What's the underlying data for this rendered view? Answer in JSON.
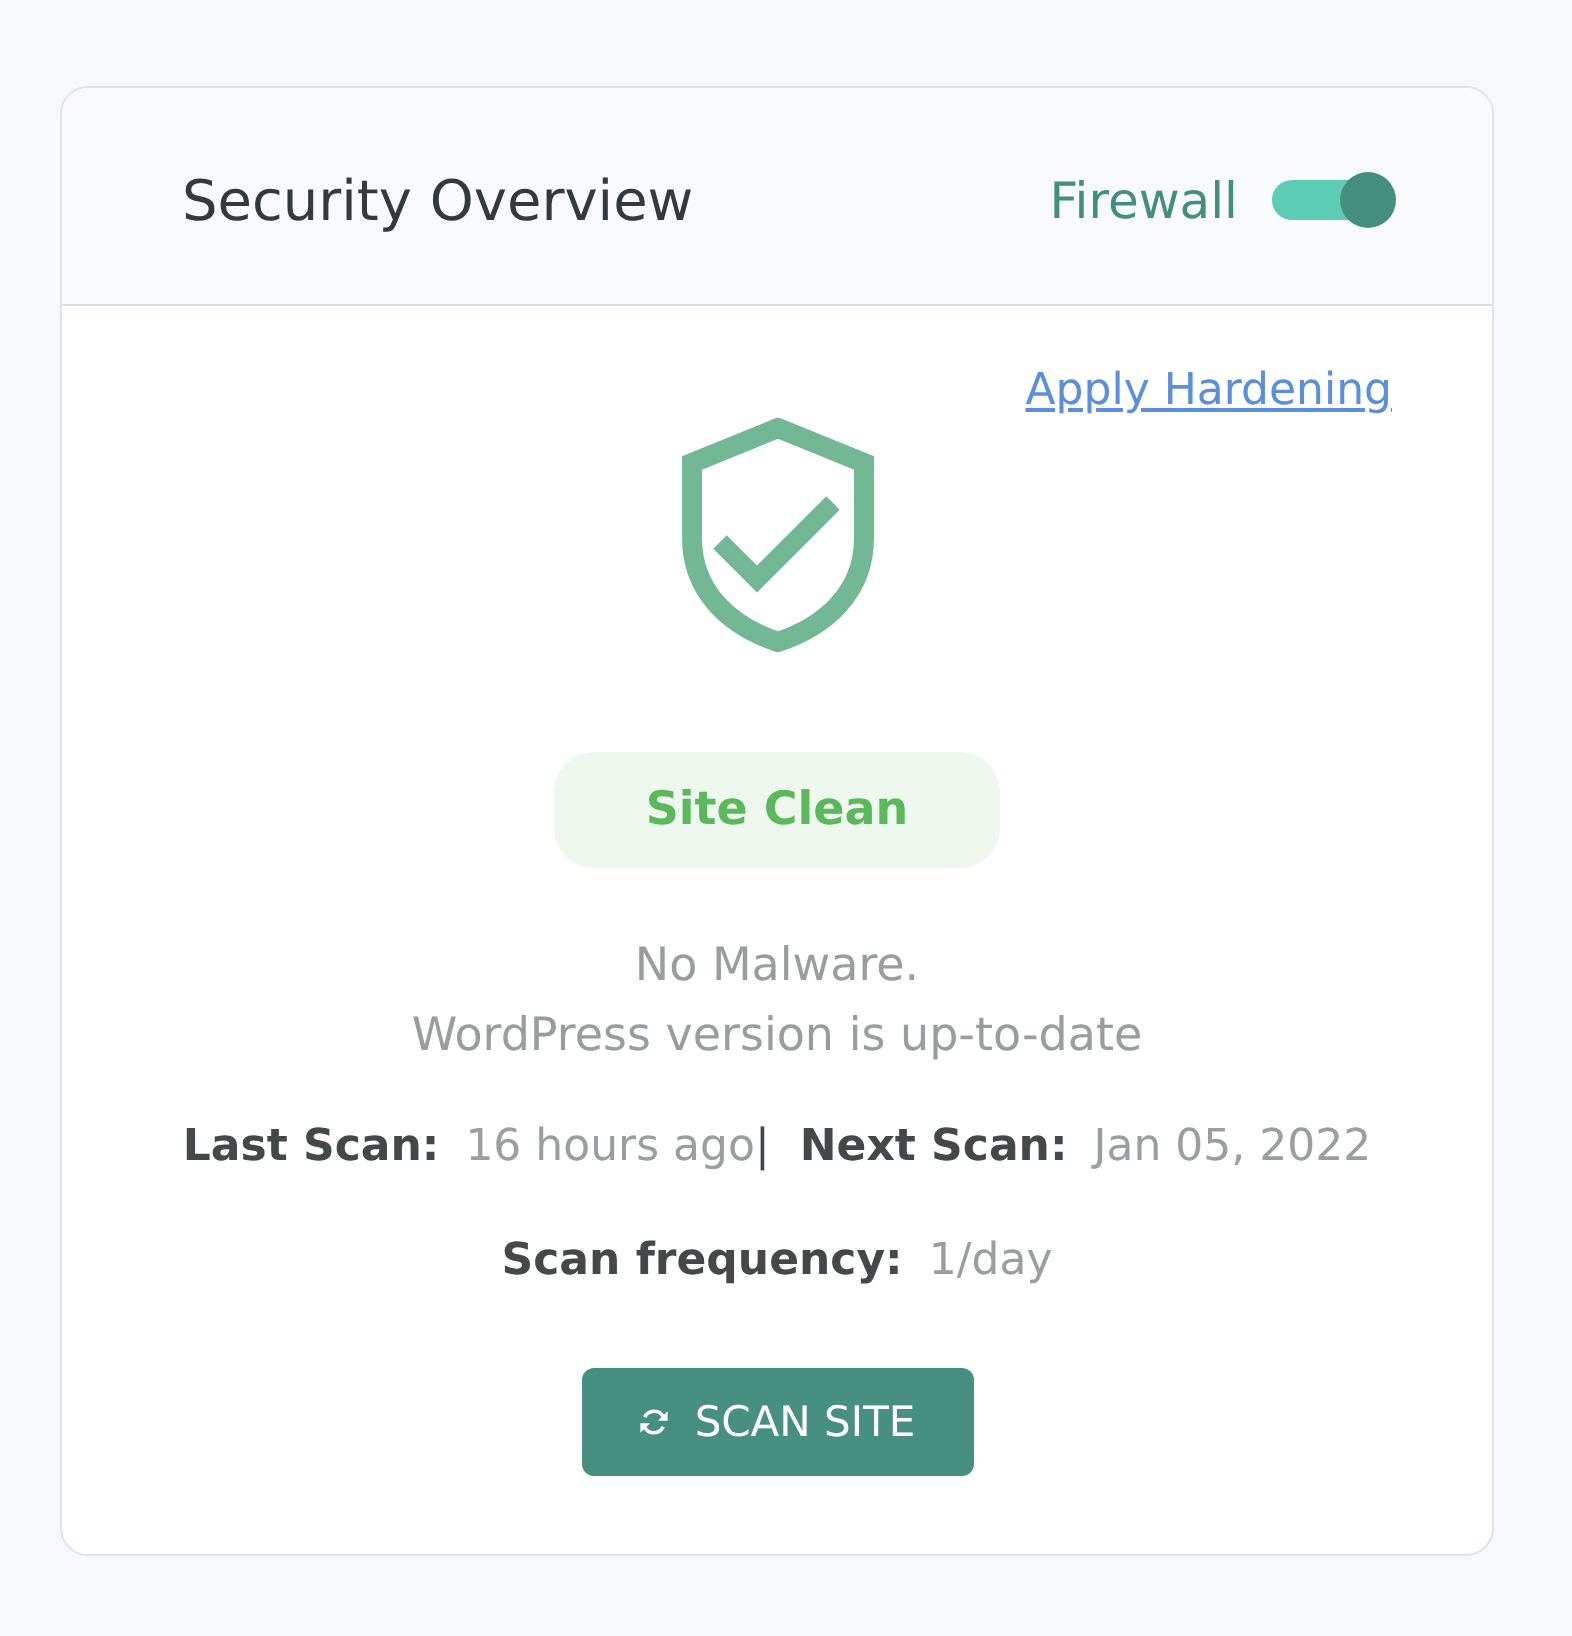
{
  "header": {
    "title": "Security Overview",
    "firewall": {
      "label": "Firewall",
      "on": true
    }
  },
  "hardening_link": "Apply Hardening",
  "status": {
    "badge": "Site Clean",
    "lines": [
      "No Malware.",
      "WordPress version is up-to-date"
    ]
  },
  "scan_info": {
    "separator": "|",
    "rows": [
      {
        "items": [
          {
            "label": "Last Scan:",
            "value": "16 hours ago"
          },
          {
            "label": "Next Scan:",
            "value": "Jan 05, 2022"
          }
        ]
      },
      {
        "items": [
          {
            "label": "Scan frequency:",
            "value": "1/day"
          }
        ]
      }
    ]
  },
  "scan_button": "SCAN SITE"
}
